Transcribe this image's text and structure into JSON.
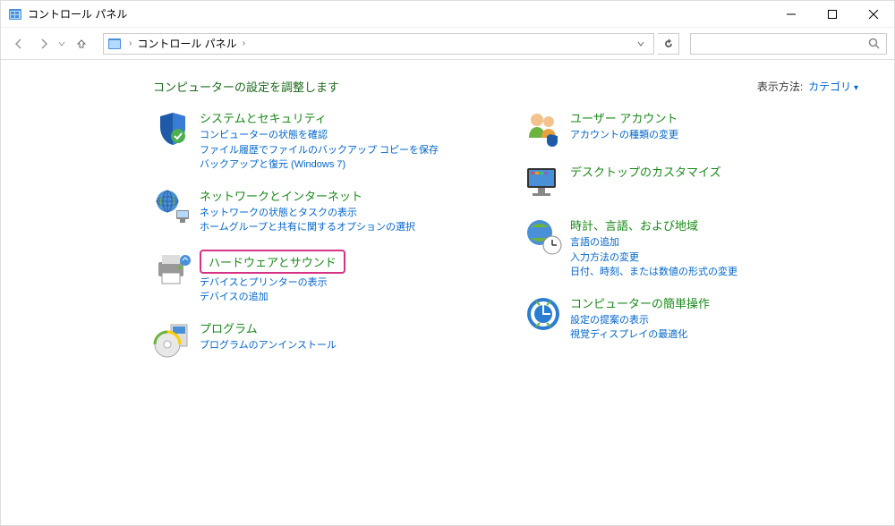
{
  "window": {
    "title": "コントロール パネル"
  },
  "breadcrumb": {
    "item1": "コントロール パネル"
  },
  "header": {
    "title": "コンピューターの設定を調整します",
    "view_label": "表示方法:",
    "view_value": "カテゴリ"
  },
  "categories": {
    "left": [
      {
        "title": "システムとセキュリティ",
        "links": [
          "コンピューターの状態を確認",
          "ファイル履歴でファイルのバックアップ コピーを保存",
          "バックアップと復元 (Windows 7)"
        ]
      },
      {
        "title": "ネットワークとインターネット",
        "links": [
          "ネットワークの状態とタスクの表示",
          "ホームグループと共有に関するオプションの選択"
        ]
      },
      {
        "title": "ハードウェアとサウンド",
        "highlighted": true,
        "links": [
          "デバイスとプリンターの表示",
          "デバイスの追加"
        ]
      },
      {
        "title": "プログラム",
        "links": [
          "プログラムのアンインストール"
        ]
      }
    ],
    "right": [
      {
        "title": "ユーザー アカウント",
        "links": [
          "アカウントの種類の変更"
        ]
      },
      {
        "title": "デスクトップのカスタマイズ",
        "links": []
      },
      {
        "title": "時計、言語、および地域",
        "links": [
          "言語の追加",
          "入力方法の変更",
          "日付、時刻、または数値の形式の変更"
        ]
      },
      {
        "title": "コンピューターの簡単操作",
        "links": [
          "設定の提案の表示",
          "視覚ディスプレイの最適化"
        ]
      }
    ]
  }
}
